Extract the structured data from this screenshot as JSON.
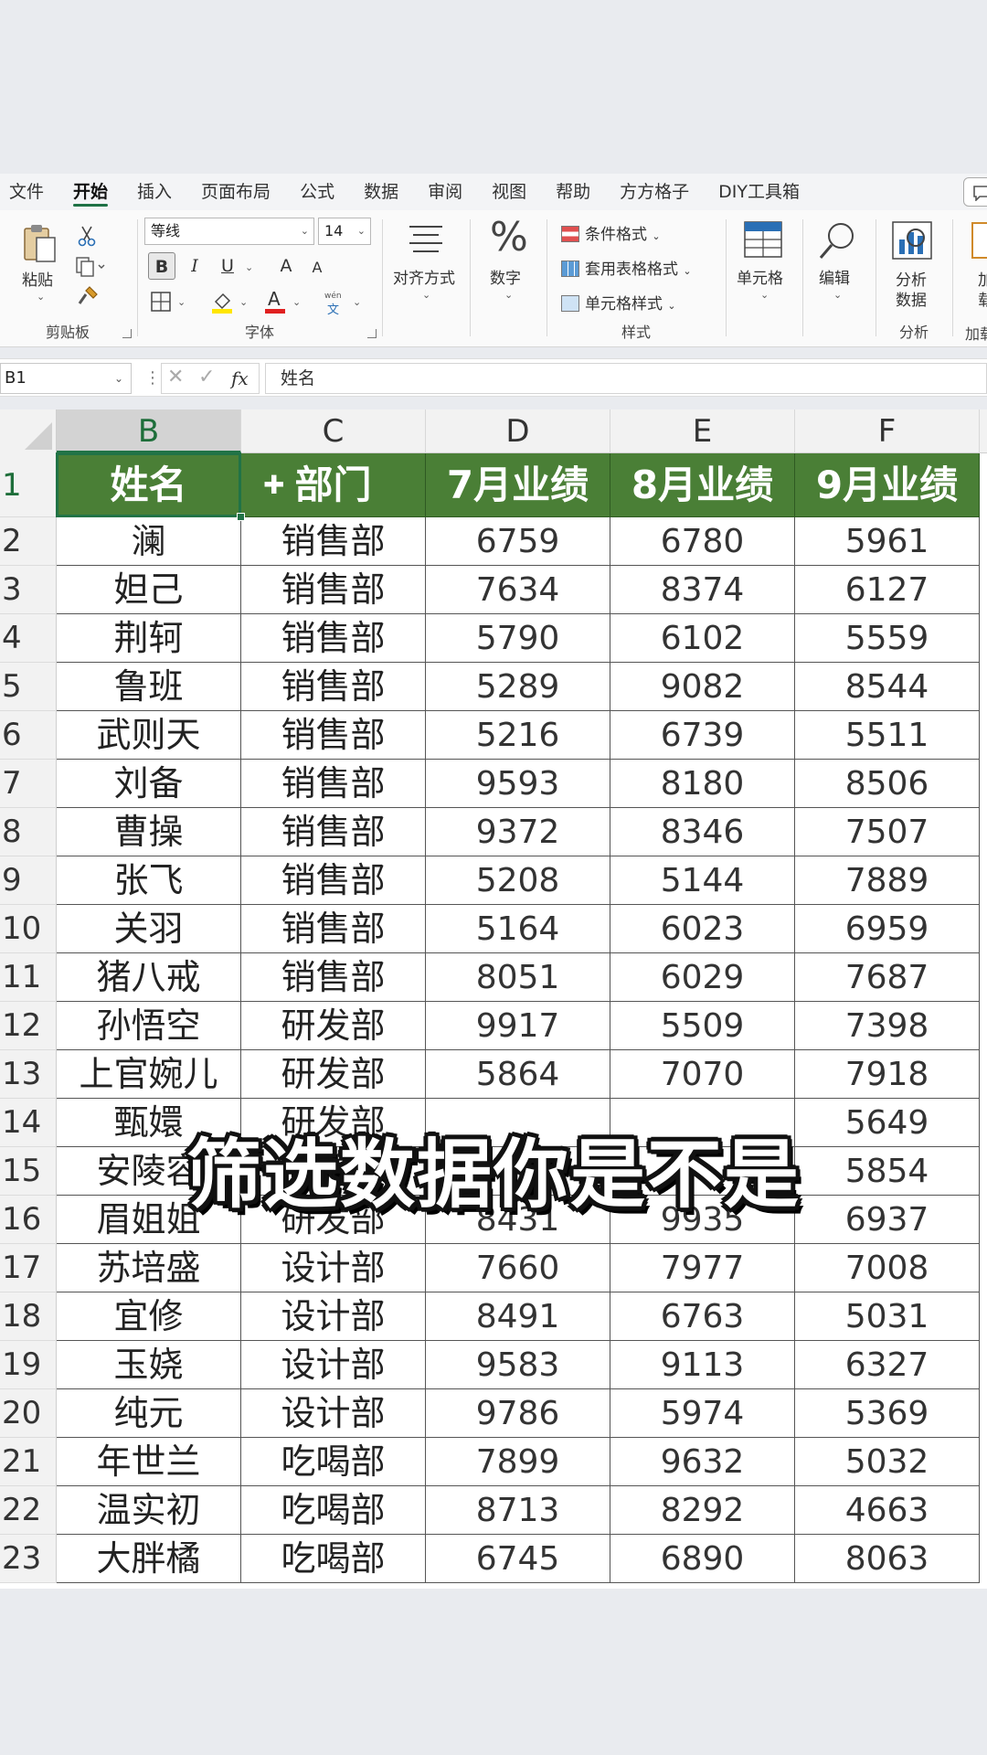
{
  "ribbon": {
    "tabs": [
      "文件",
      "开始",
      "插入",
      "页面布局",
      "公式",
      "数据",
      "审阅",
      "视图",
      "帮助",
      "方方格子",
      "DIY工具箱"
    ],
    "active_tab": "开始",
    "clipboard": {
      "paste": "粘贴",
      "group": "剪贴板"
    },
    "font": {
      "name": "等线",
      "size": "14",
      "group": "字体",
      "bold": "B",
      "italic": "I",
      "underline": "U",
      "grow": "A",
      "shrink": "A",
      "phonetic": "文"
    },
    "align": {
      "label": "对齐方式"
    },
    "number": {
      "symbol": "%",
      "label": "数字"
    },
    "styles": {
      "cond": "条件格式",
      "table": "套用表格格式",
      "cell": "单元格样式",
      "group": "样式"
    },
    "cells": {
      "label": "单元格"
    },
    "edit": {
      "label": "编辑"
    },
    "analysis": {
      "line1": "分析",
      "line2": "数据",
      "group": "分析"
    },
    "addin": {
      "line1": "加",
      "line2": "载",
      "group": "加载"
    }
  },
  "formula_bar": {
    "cell_ref": "B1",
    "content": "姓名"
  },
  "columns": [
    "B",
    "C",
    "D",
    "E",
    "F"
  ],
  "selected_column": "B",
  "header_row": {
    "row": "1",
    "cells": [
      "姓名",
      "部门",
      "7月业绩",
      "8月业绩",
      "9月业绩"
    ]
  },
  "rows": [
    {
      "row": "2",
      "cells": [
        "澜",
        "销售部",
        "6759",
        "6780",
        "5961"
      ]
    },
    {
      "row": "3",
      "cells": [
        "妲己",
        "销售部",
        "7634",
        "8374",
        "6127"
      ]
    },
    {
      "row": "4",
      "cells": [
        "荆轲",
        "销售部",
        "5790",
        "6102",
        "5559"
      ]
    },
    {
      "row": "5",
      "cells": [
        "鲁班",
        "销售部",
        "5289",
        "9082",
        "8544"
      ]
    },
    {
      "row": "6",
      "cells": [
        "武则天",
        "销售部",
        "5216",
        "6739",
        "5511"
      ]
    },
    {
      "row": "7",
      "cells": [
        "刘备",
        "销售部",
        "9593",
        "8180",
        "8506"
      ]
    },
    {
      "row": "8",
      "cells": [
        "曹操",
        "销售部",
        "9372",
        "8346",
        "7507"
      ]
    },
    {
      "row": "9",
      "cells": [
        "张飞",
        "销售部",
        "5208",
        "5144",
        "7889"
      ]
    },
    {
      "row": "10",
      "cells": [
        "关羽",
        "销售部",
        "5164",
        "6023",
        "6959"
      ]
    },
    {
      "row": "11",
      "cells": [
        "猪八戒",
        "销售部",
        "8051",
        "6029",
        "7687"
      ]
    },
    {
      "row": "12",
      "cells": [
        "孙悟空",
        "研发部",
        "9917",
        "5509",
        "7398"
      ]
    },
    {
      "row": "13",
      "cells": [
        "上官婉儿",
        "研发部",
        "5864",
        "7070",
        "7918"
      ]
    },
    {
      "row": "14",
      "cells": [
        "甄嬛",
        "研发部",
        "",
        "",
        "5649"
      ]
    },
    {
      "row": "15",
      "cells": [
        "安陵容",
        "",
        "",
        "",
        "5854"
      ]
    },
    {
      "row": "16",
      "cells": [
        "眉姐姐",
        "研发部",
        "8431",
        "9935",
        "6937"
      ]
    },
    {
      "row": "17",
      "cells": [
        "苏培盛",
        "设计部",
        "7660",
        "7977",
        "7008"
      ]
    },
    {
      "row": "18",
      "cells": [
        "宜修",
        "设计部",
        "8491",
        "6763",
        "5031"
      ]
    },
    {
      "row": "19",
      "cells": [
        "玉娆",
        "设计部",
        "9583",
        "9113",
        "6327"
      ]
    },
    {
      "row": "20",
      "cells": [
        "纯元",
        "设计部",
        "9786",
        "5974",
        "5369"
      ]
    },
    {
      "row": "21",
      "cells": [
        "年世兰",
        "吃喝部",
        "7899",
        "9632",
        "5032"
      ]
    },
    {
      "row": "22",
      "cells": [
        "温实初",
        "吃喝部",
        "8713",
        "8292",
        "4663"
      ]
    },
    {
      "row": "23",
      "cells": [
        "大胖橘",
        "吃喝部",
        "6745",
        "6890",
        "8063"
      ]
    }
  ],
  "subtitle": "筛选数据你是不是",
  "colors": {
    "header_green": "#4a7f36",
    "accent": "#217346"
  }
}
